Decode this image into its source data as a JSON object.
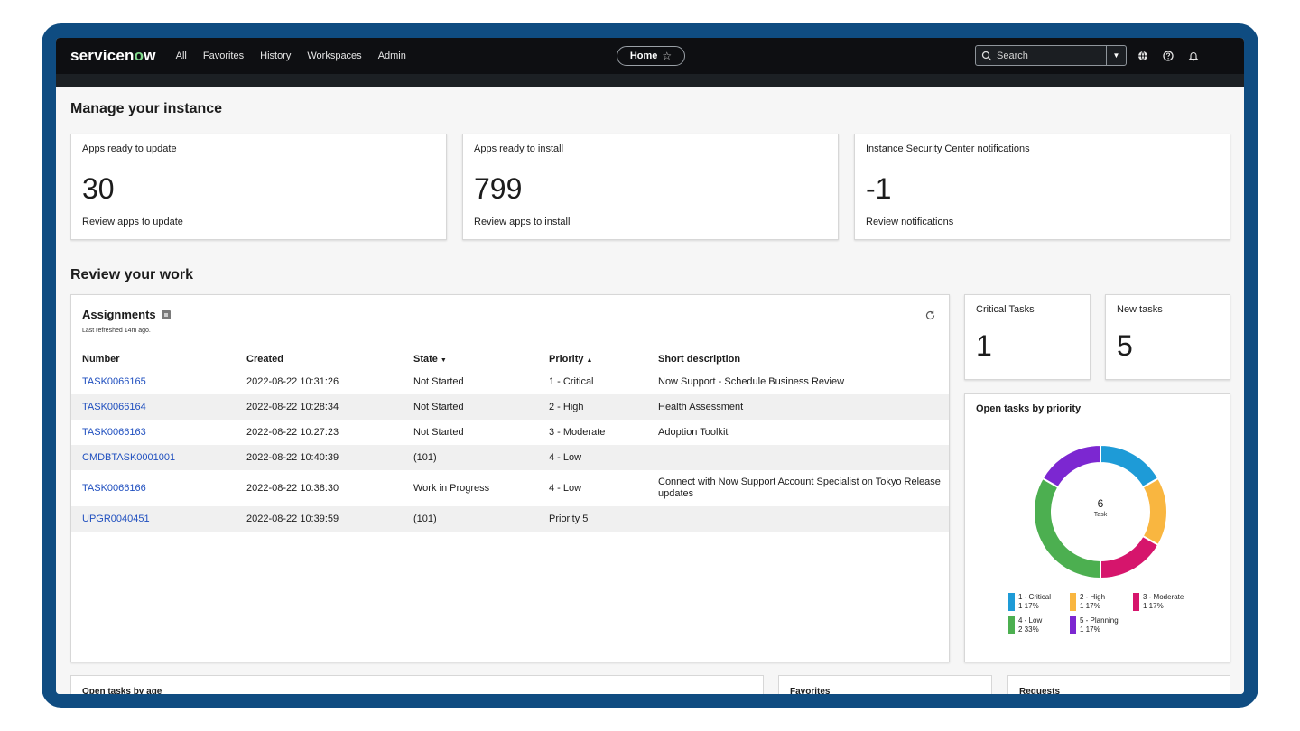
{
  "nav": {
    "logo": "servicenow",
    "items": [
      "All",
      "Favorites",
      "History",
      "Workspaces",
      "Admin"
    ],
    "home_label": "Home",
    "search_placeholder": "Search"
  },
  "manage": {
    "heading": "Manage your instance",
    "cards": [
      {
        "title": "Apps ready to update",
        "value": "30",
        "link": "Review apps to update"
      },
      {
        "title": "Apps ready to install",
        "value": "799",
        "link": "Review apps to install"
      },
      {
        "title": "Instance Security Center notifications",
        "value": "-1",
        "link": "Review notifications"
      }
    ]
  },
  "review": {
    "heading": "Review your work",
    "assignments": {
      "title": "Assignments",
      "refreshed": "Last refreshed 14m ago.",
      "columns": [
        "Number",
        "Created",
        "State",
        "Priority",
        "Short description"
      ],
      "rows": [
        {
          "number": "TASK0066165",
          "created": "2022-08-22 10:31:26",
          "state": "Not Started",
          "priority": "1 - Critical",
          "desc": "Now Support - Schedule Business Review"
        },
        {
          "number": "TASK0066164",
          "created": "2022-08-22 10:28:34",
          "state": "Not Started",
          "priority": "2 - High",
          "desc": "Health Assessment"
        },
        {
          "number": "TASK0066163",
          "created": "2022-08-22 10:27:23",
          "state": "Not Started",
          "priority": "3 - Moderate",
          "desc": "Adoption Toolkit"
        },
        {
          "number": "CMDBTASK0001001",
          "created": "2022-08-22 10:40:39",
          "state": "(101)",
          "priority": "4 - Low",
          "desc": ""
        },
        {
          "number": "TASK0066166",
          "created": "2022-08-22 10:38:30",
          "state": "Work in Progress",
          "priority": "4 - Low",
          "desc": "Connect with Now Support Account Specialist on Tokyo Release updates"
        },
        {
          "number": "UPGR0040451",
          "created": "2022-08-22 10:39:59",
          "state": "(101)",
          "priority": "Priority 5",
          "desc": ""
        }
      ]
    },
    "critical": {
      "title": "Critical Tasks",
      "value": "1"
    },
    "newtasks": {
      "title": "New tasks",
      "value": "5"
    },
    "priority_chart": {
      "title": "Open tasks by priority",
      "center_value": "6",
      "center_label": "Task"
    }
  },
  "bottom": {
    "cards": [
      "Open tasks by age",
      "Favorites",
      "Requests"
    ]
  },
  "chart_data": {
    "type": "pie",
    "title": "Open tasks by priority",
    "categories": [
      "1 - Critical",
      "2 - High",
      "3 - Moderate",
      "4 - Low",
      "5 - Planning"
    ],
    "values": [
      1,
      1,
      1,
      2,
      1
    ],
    "percent_labels": [
      "17%",
      "17%",
      "17%",
      "33%",
      "17%"
    ],
    "colors": [
      "#1e9bd7",
      "#f9b640",
      "#d6156c",
      "#4caf50",
      "#7c27d1"
    ],
    "total": 6,
    "legend_position": "bottom"
  }
}
